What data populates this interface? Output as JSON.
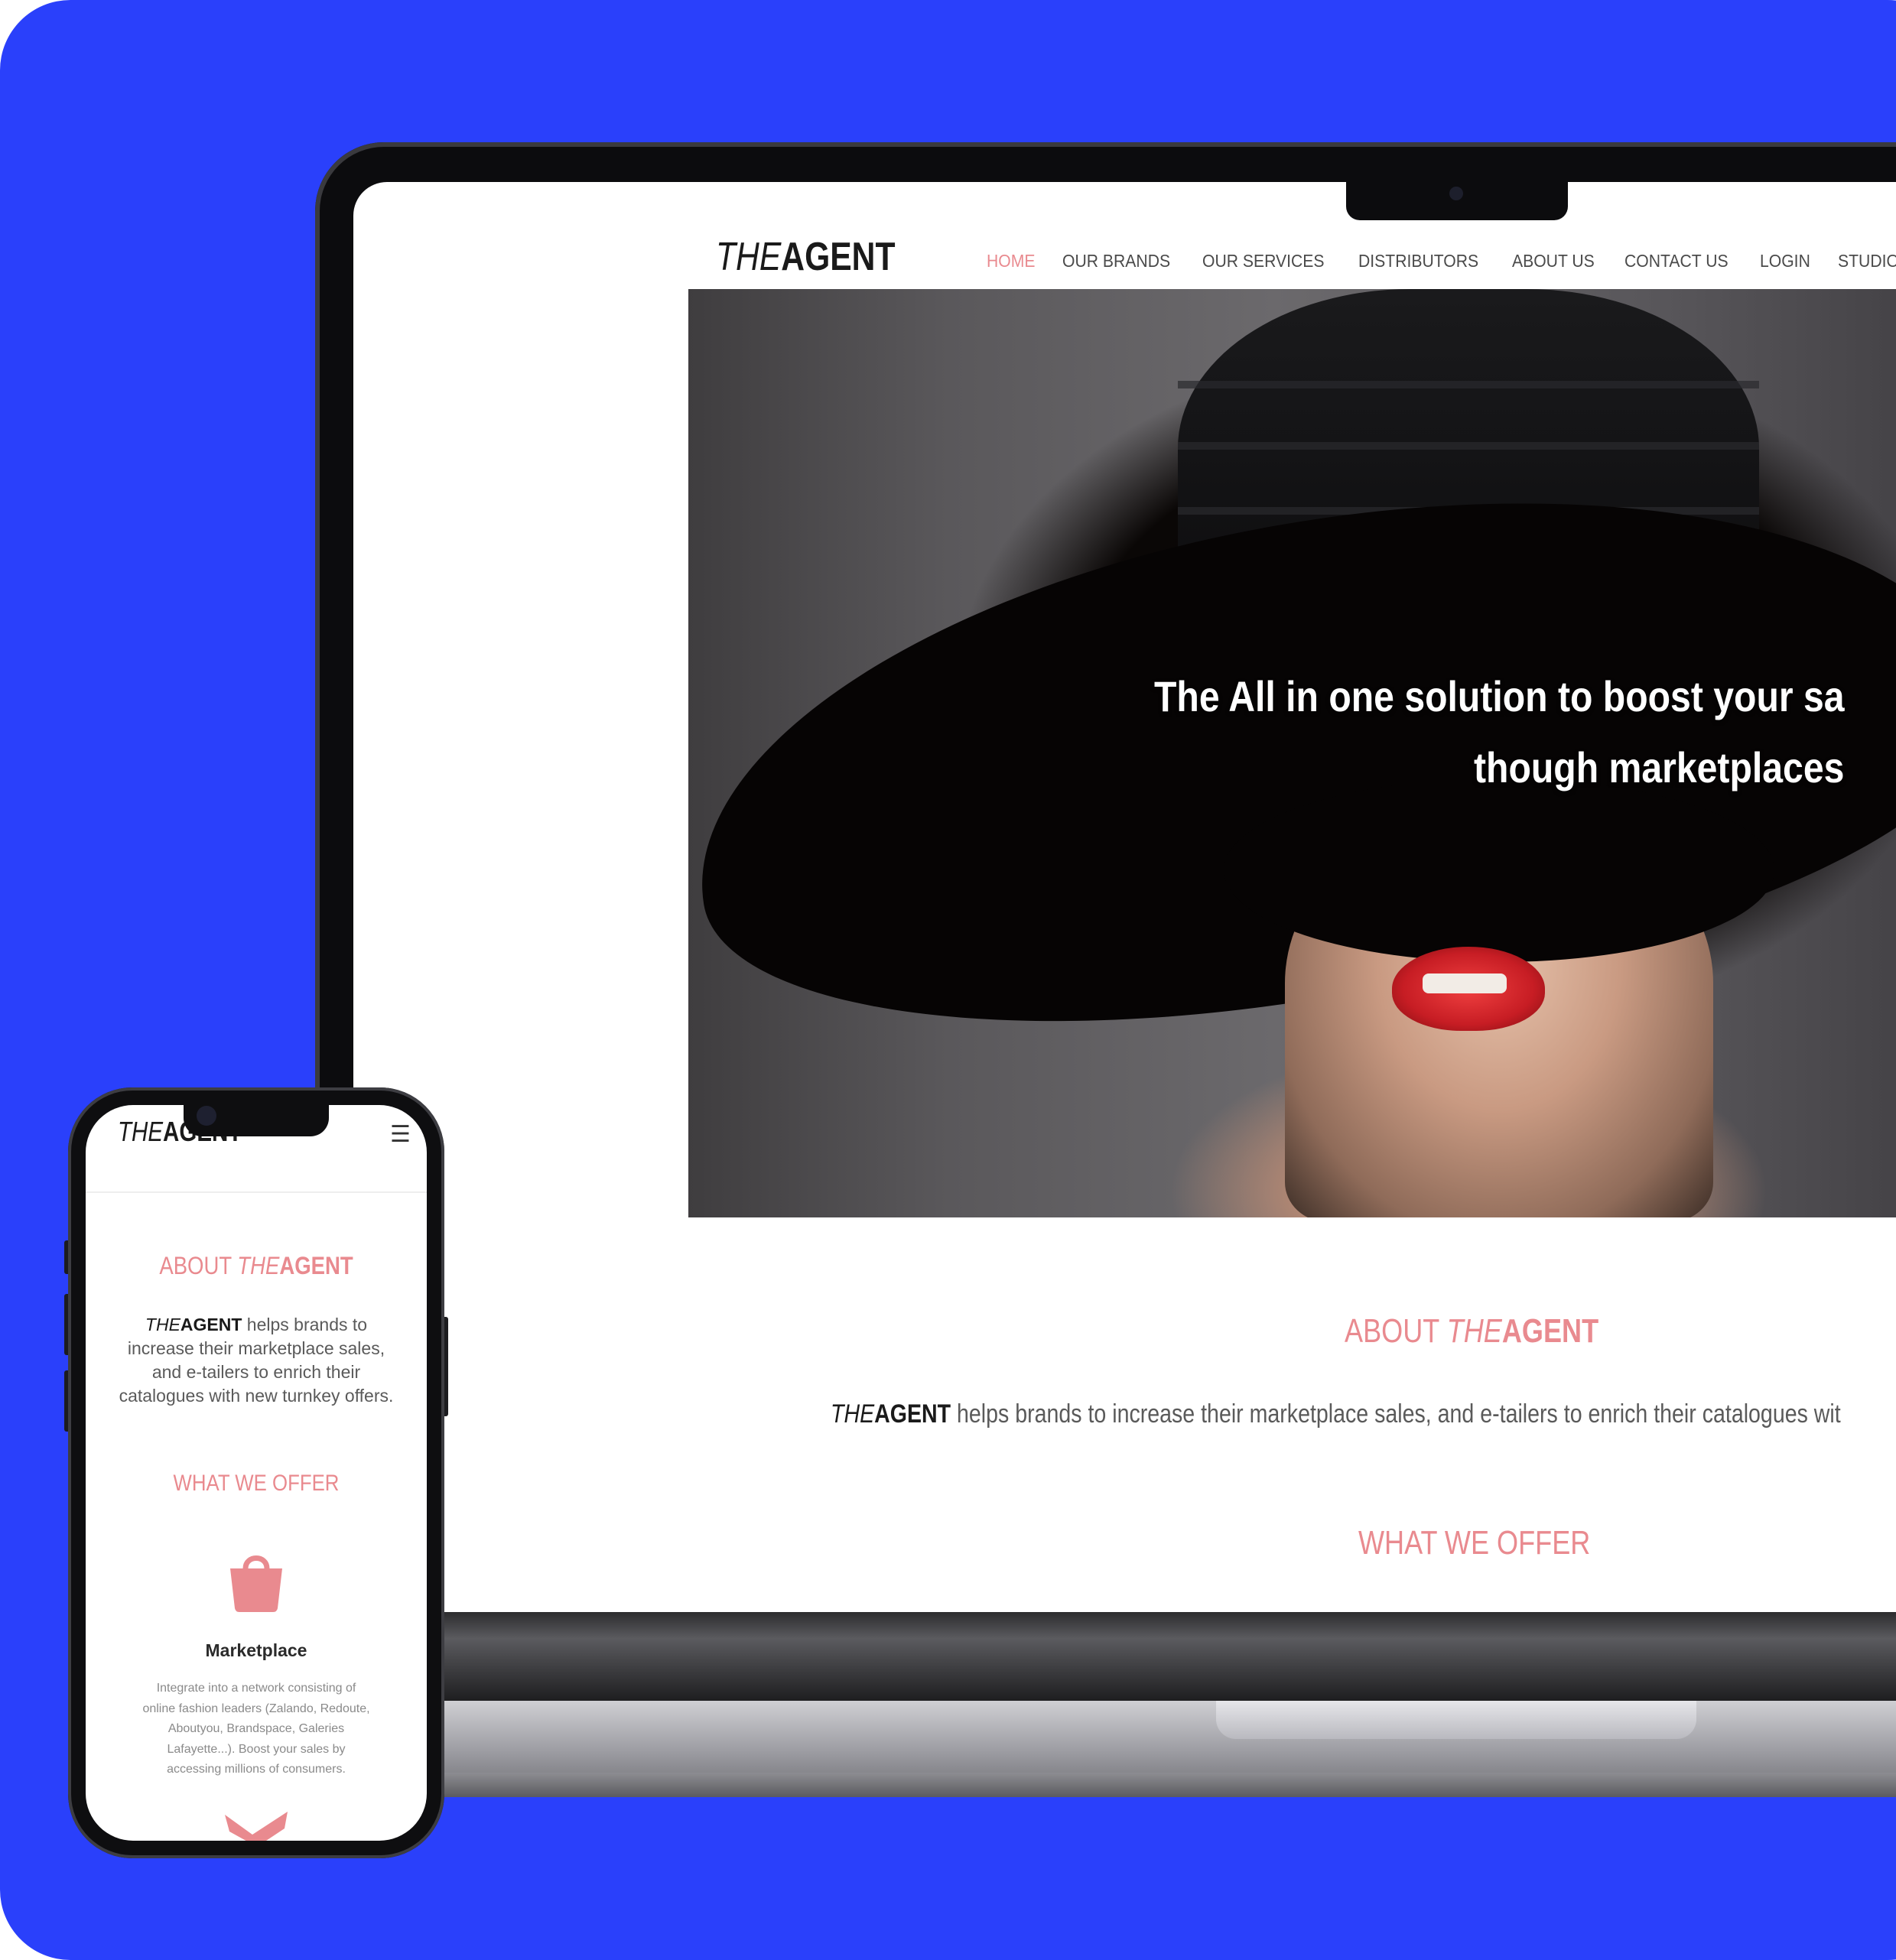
{
  "brand": {
    "logo_the": "THE",
    "logo_agent": "AGENT"
  },
  "desktop": {
    "nav": [
      "HOME",
      "OUR BRANDS",
      "OUR SERVICES",
      "DISTRIBUTORS",
      "ABOUT US",
      "CONTACT US",
      "LOGIN",
      "STUDIO PHOTO"
    ],
    "nav_active": "HOME",
    "hero": {
      "line1": "The All in one solution to boost your sa",
      "line2": "though marketplaces"
    },
    "about": {
      "title_prefix": "ABOUT ",
      "title_the": "THE",
      "title_agent": "AGENT",
      "body_the": "THE",
      "body_agent": "AGENT",
      "body_text": " helps brands to increase their marketplace sales, and e-tailers to enrich their catalogues wit"
    },
    "offer_title": "WHAT WE OFFER"
  },
  "mobile": {
    "logo_the": "THE",
    "logo_agent": "AGENT",
    "menu_icon": "hamburger-menu-icon",
    "about": {
      "title_prefix": "ABOUT ",
      "title_the": "THE",
      "title_agent": "AGENT",
      "body_the": "THE",
      "body_agent": "AGENT",
      "body_text": " helps brands to increase their marketplace sales, and e-tailers to enrich their catalogues with new turnkey offers."
    },
    "offer_title": "WHAT WE OFFER",
    "item": {
      "icon": "shopping-bag-icon",
      "title": "Marketplace",
      "body": "Integrate into a network consisting of online fashion leaders (Zalando, Redoute, Aboutyou, Brandspace, Galeries Lafayette...). Boost your sales by accessing millions of consumers."
    }
  },
  "colors": {
    "background": "#2a40fb",
    "accent": "#e98a8f",
    "text_dark": "#1a1a1a",
    "text_body": "#5a5a5a"
  }
}
